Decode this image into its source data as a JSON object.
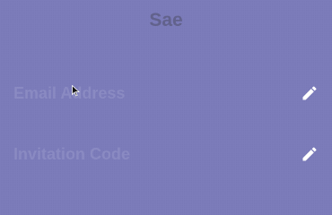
{
  "header": {
    "title": "Sae"
  },
  "fields": [
    {
      "label": "Email Address",
      "action_icon": "pencil-icon"
    },
    {
      "label": "Invitation Code",
      "action_icon": "pencil-icon"
    }
  ],
  "colors": {
    "background": "#7878b8",
    "title": "#62628c",
    "label": "#8a8ac2",
    "icon": "#ffffff"
  }
}
